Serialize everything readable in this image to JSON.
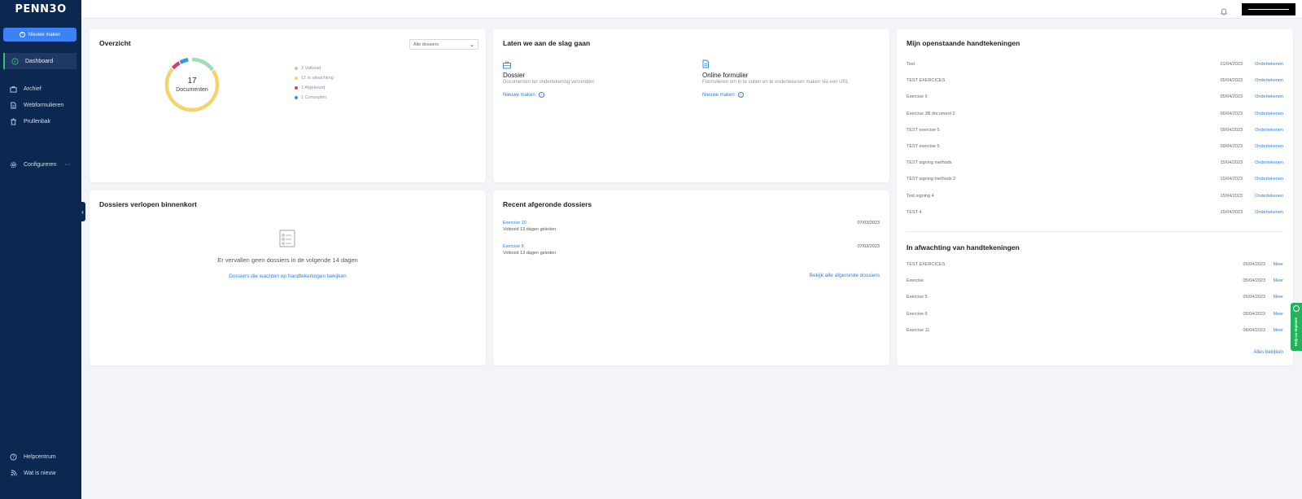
{
  "app": {
    "logo": "PENN3O"
  },
  "sidebar": {
    "new_button": "Nieuwe maken",
    "items": [
      {
        "label": "Dashboard"
      },
      {
        "label": "Archief"
      },
      {
        "label": "Webformulieren"
      },
      {
        "label": "Prullenbak"
      },
      {
        "label": "Configureren"
      },
      {
        "label": "Helpcentrum"
      },
      {
        "label": "Wat is nieuw"
      }
    ],
    "configure_more": "···"
  },
  "overview": {
    "title": "Overzicht",
    "filter_value": "Alle dossiers",
    "total": "17",
    "total_label": "Documenten",
    "legend": [
      {
        "label": "3 Voltooid",
        "color": "#9fdcb0",
        "count": 3
      },
      {
        "label": "12 in afwachting",
        "color": "#f5d36b",
        "count": 12
      },
      {
        "label": "1 Afgekeurd",
        "color": "#e03a6a",
        "count": 1
      },
      {
        "label": "1 Concepten",
        "color": "#2d9cdb",
        "count": 1
      }
    ]
  },
  "getting_started": {
    "title": "Laten we aan de slag gaan",
    "dossier": {
      "title": "Dossier",
      "desc": "Documenten ter ondertekening verzenden",
      "link": "Nieuwe maken"
    },
    "form": {
      "title": "Online formulier",
      "desc": "Formulieren om in te vullen en te ondertekenen maken via een URL",
      "link": "Nieuwe maken"
    }
  },
  "expiring": {
    "title": "Dossiers verlopen binnenkort",
    "empty_text": "Er vervallen geen dossiers in de volgende 14 dagen",
    "link": "Dossiers die wachten op handtekeningen bekijken"
  },
  "recent": {
    "title": "Recent afgeronde dossiers",
    "items": [
      {
        "name": "Exercise 10",
        "status": "Voltooid 13 dagen geleden",
        "date": "07/03/2023"
      },
      {
        "name": "Exercise 8",
        "status": "Voltooid 13 dagen geleden",
        "date": "07/03/2023"
      }
    ],
    "link": "Bekijk alle afgeronde dossiers"
  },
  "pending_signatures": {
    "title": "Mijn openstaande handtekeningen",
    "rows": [
      {
        "name": "Test",
        "date": "01/04/2023",
        "action": "Ondertekenen"
      },
      {
        "name": "TEST EXERCICES",
        "date": "05/04/2023",
        "action": "Ondertekenen"
      },
      {
        "name": "Exercise 6",
        "date": "05/04/2023",
        "action": "Ondertekenen"
      },
      {
        "name": "Exercise 3B document 2",
        "date": "06/04/2023",
        "action": "Ondertekenen"
      },
      {
        "name": "TEST exercise 5",
        "date": "09/04/2023",
        "action": "Ondertekenen"
      },
      {
        "name": "TEST exercise 5",
        "date": "09/04/2023",
        "action": "Ondertekenen"
      },
      {
        "name": "TEST signing methods",
        "date": "15/04/2023",
        "action": "Ondertekenen"
      },
      {
        "name": "TEST signing methods 2",
        "date": "15/04/2023",
        "action": "Ondertekenen"
      },
      {
        "name": "Test signing 4",
        "date": "15/04/2023",
        "action": "Ondertekenen"
      },
      {
        "name": "TEST 4",
        "date": "15/04/2023",
        "action": "Ondertekenen"
      }
    ]
  },
  "awaiting": {
    "title": "In afwachting van handtekeningen",
    "rows": [
      {
        "name": "TEST EXERCICES",
        "date": "05/04/2023",
        "action": "Meer"
      },
      {
        "name": "Exercise",
        "date": "05/04/2023",
        "action": "Meer"
      },
      {
        "name": "Exercise 5",
        "date": "05/04/2023",
        "action": "Meer"
      },
      {
        "name": "Exercise 6",
        "date": "05/04/2023",
        "action": "Meer"
      },
      {
        "name": "Exercise 11",
        "date": "06/04/2023",
        "action": "Meer"
      }
    ],
    "link": "Alles bekijken"
  },
  "help_tab": "Help us improve",
  "colors": {
    "sidebar": "#0d2850",
    "accent": "#3b82f6",
    "link": "#2f7de1",
    "success": "#22b35a"
  }
}
